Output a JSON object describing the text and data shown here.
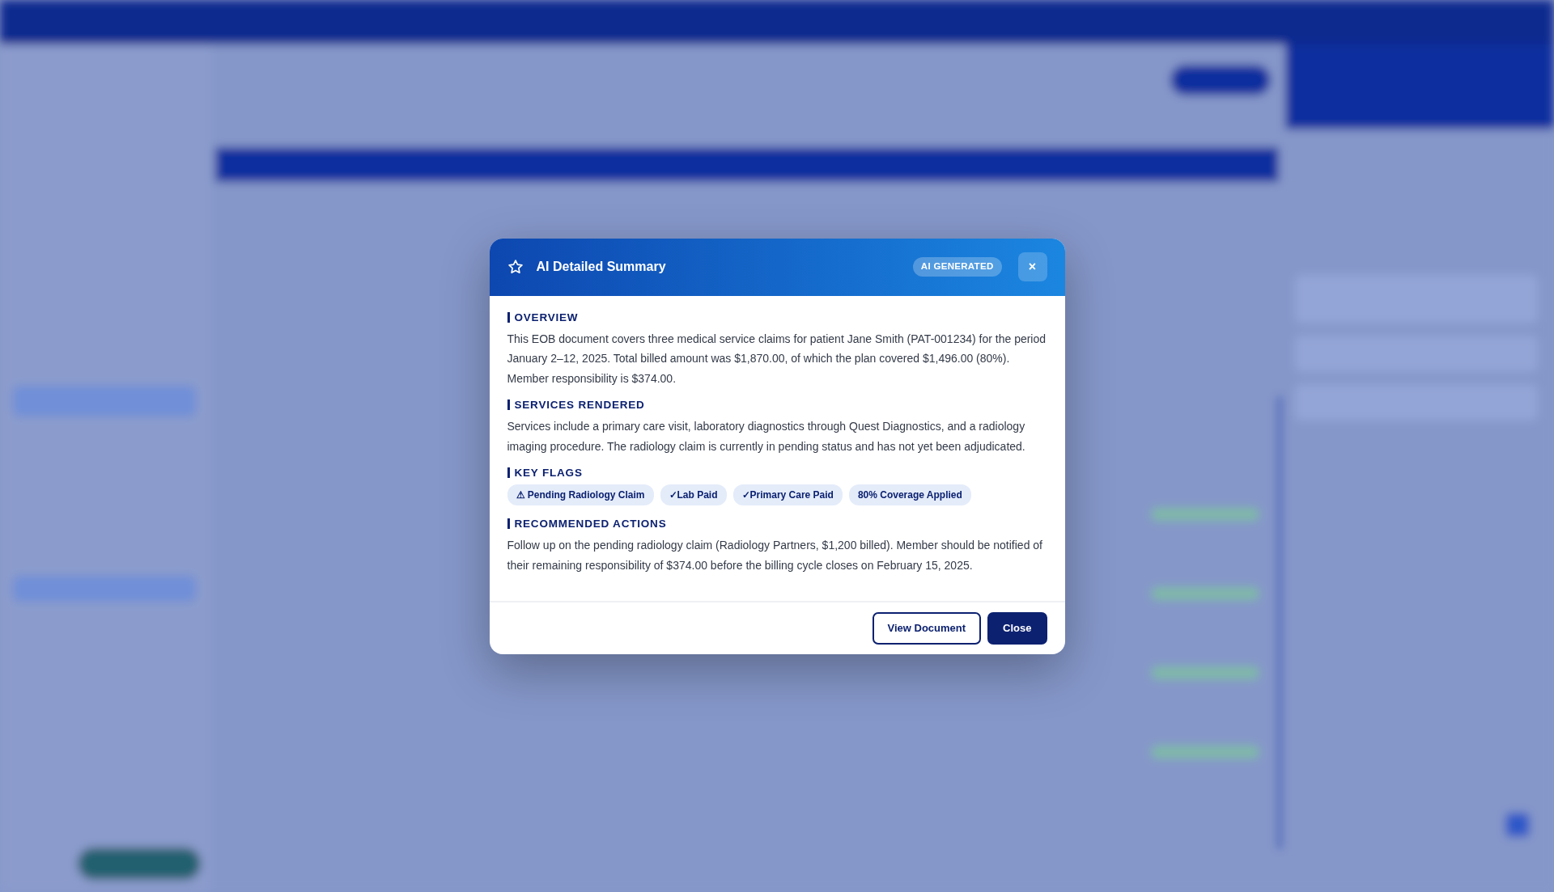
{
  "modal": {
    "title": "AI Detailed Summary",
    "badge": "AI GENERATED",
    "close_glyph": "×",
    "sections": [
      {
        "kind": "text",
        "heading": "OVERVIEW",
        "text": "This EOB document covers three medical service claims for patient Jane Smith (PAT-001234) for the period January 2–12, 2025. Total billed amount was $1,870.00, of which the plan covered $1,496.00 (80%). Member responsibility is $374.00."
      },
      {
        "kind": "text",
        "heading": "SERVICES RENDERED",
        "text": "Services include a primary care visit, laboratory diagnostics through Quest Diagnostics, and a radiology imaging procedure. The radiology claim is currently in pending status and has not yet been adjudicated."
      },
      {
        "kind": "flags",
        "heading": "KEY FLAGS",
        "flags": [
          "⚠ Pending Radiology Claim",
          "✓Lab Paid",
          "✓Primary Care Paid",
          "80% Coverage Applied"
        ]
      },
      {
        "kind": "text",
        "heading": "RECOMMENDED ACTIONS",
        "text": "Follow up on the pending radiology claim (Radiology Partners, $1,200 billed). Member should be notified of their remaining responsibility of $374.00 before the billing cycle closes on February 15, 2025."
      }
    ],
    "buttons": [
      {
        "label": "View Document",
        "kind": "outline"
      },
      {
        "label": "Close",
        "kind": "primary"
      }
    ]
  }
}
